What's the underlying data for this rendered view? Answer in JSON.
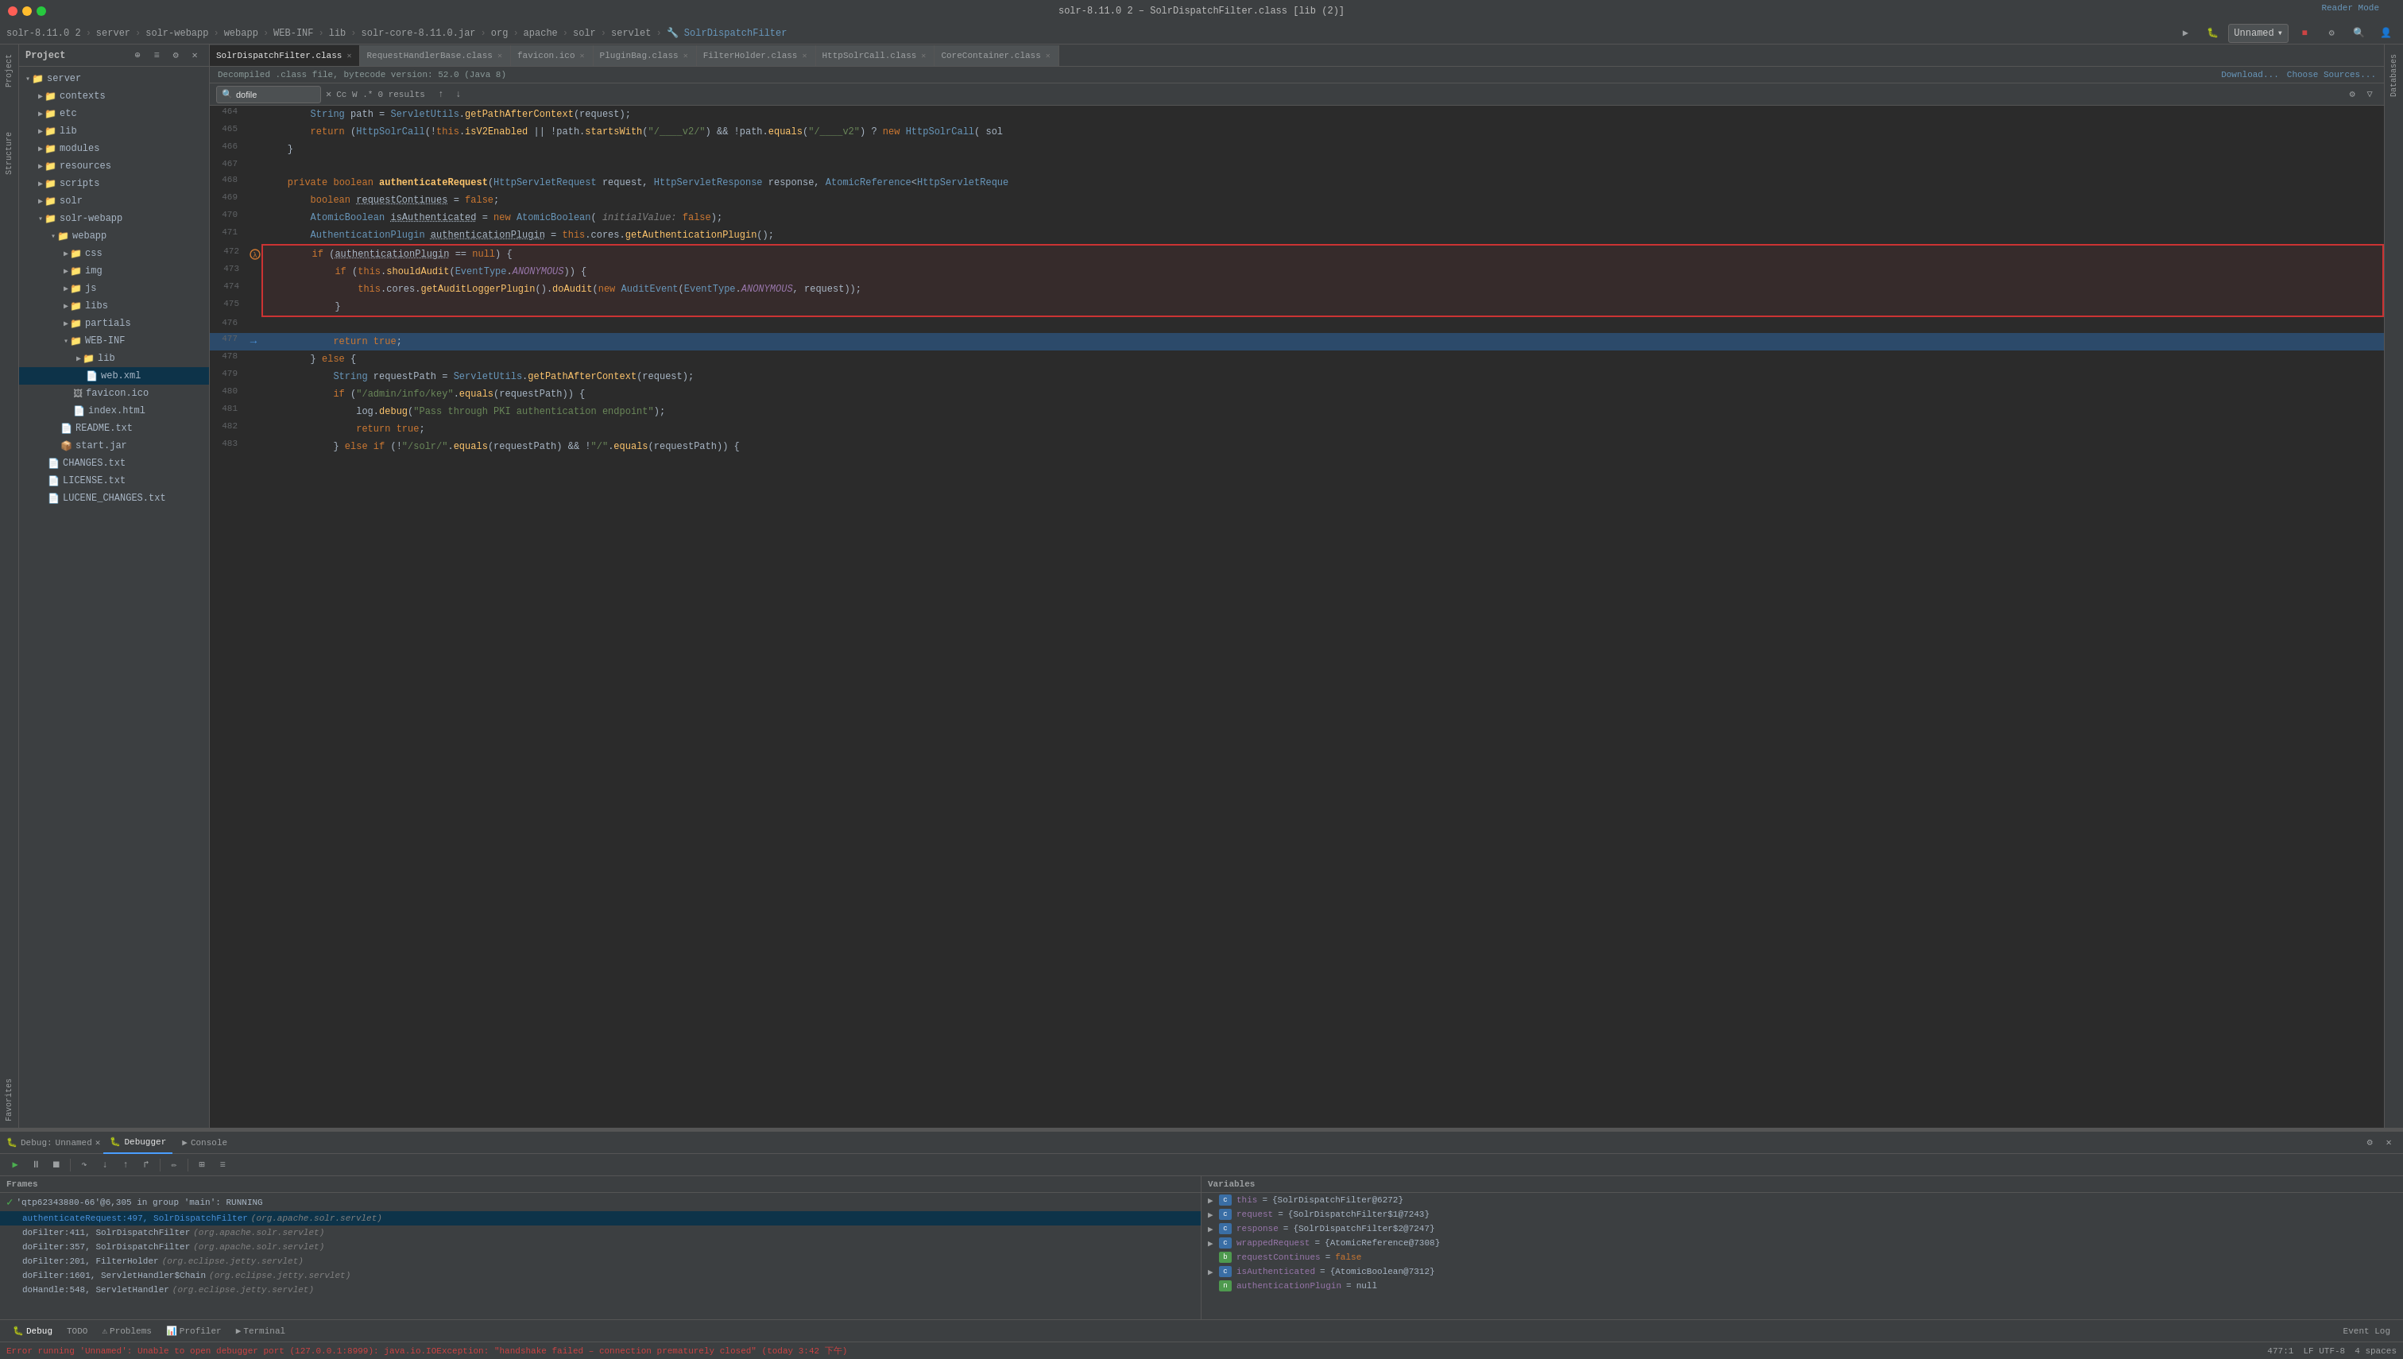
{
  "titleBar": {
    "title": "solr-8.11.0 2 – SolrDispatchFilter.class [lib (2)]"
  },
  "navBar": {
    "items": [
      "solr-8.11.0 2",
      "server",
      "solr-webapp",
      "webapp",
      "WEB-INF",
      "lib",
      "solr-core-8.11.0.jar",
      "org",
      "apache",
      "solr",
      "servlet",
      "SolrDispatchFilter"
    ]
  },
  "tabs": [
    {
      "label": "SolrDispatchFilter.class",
      "active": true
    },
    {
      "label": "RequestHandlerBase.class",
      "active": false
    },
    {
      "label": "favicon.ico",
      "active": false
    },
    {
      "label": "PluginBag.class",
      "active": false
    },
    {
      "label": "FilterHolder.class",
      "active": false
    },
    {
      "label": "HttpSolrCall.class",
      "active": false
    },
    {
      "label": "CoreContainer.class",
      "active": false
    }
  ],
  "fileBanner": {
    "text": "Decompiled .class file, bytecode version: 52.0 (Java 8)",
    "downloadLabel": "Download...",
    "chooseSourcesLabel": "Choose Sources..."
  },
  "searchBar": {
    "placeholder": "dofile",
    "value": "dofile",
    "results": "0 results"
  },
  "readerMode": "Reader Mode",
  "codeLines": [
    {
      "num": 464,
      "text": "        String path = ServletUtils.getPathAfterContext(request);"
    },
    {
      "num": 465,
      "text": "        return (HttpSolrCall(!this.isV2Enabled || !path.startsWith(\"/____v2/\") && !path.equals(\"/____v2\") ? new HttpSolrCall( sol"
    },
    {
      "num": 466,
      "text": "    }"
    },
    {
      "num": 467,
      "text": ""
    },
    {
      "num": 468,
      "text": "    private boolean authenticateRequest(HttpServletRequest request, HttpServletResponse response, AtomicReference<HttpServletReque"
    },
    {
      "num": 469,
      "text": "        boolean requestContinues = false;"
    },
    {
      "num": 470,
      "text": "        AtomicBoolean isAuthenticated = new AtomicBoolean( initialValue: false);"
    },
    {
      "num": 471,
      "text": "        AuthenticationPlugin authenticationPlugin = this.cores.getAuthenticationPlugin();"
    },
    {
      "num": 472,
      "text": "        if (authenticationPlugin == null) {",
      "redBox": "top"
    },
    {
      "num": 473,
      "text": "            if (this.shouldAudit(EventType.ANONYMOUS)) {",
      "redBox": "mid"
    },
    {
      "num": 474,
      "text": "                this.cores.getAuditLoggerPlugin().doAudit(new AuditEvent(EventType.ANONYMOUS, request));",
      "redBox": "mid"
    },
    {
      "num": 475,
      "text": "            }",
      "redBox": "bottom"
    },
    {
      "num": 476,
      "text": ""
    },
    {
      "num": 477,
      "text": "            return true;",
      "current": true
    },
    {
      "num": 478,
      "text": "        } else {"
    },
    {
      "num": 479,
      "text": "            String requestPath = ServletUtils.getPathAfterContext(request);"
    },
    {
      "num": 480,
      "text": "            if (\"/admin/info/key\".equals(requestPath)) {"
    },
    {
      "num": 481,
      "text": "                log.debug(\"Pass through PKI authentication endpoint\");"
    },
    {
      "num": 482,
      "text": "                return true;"
    },
    {
      "num": 483,
      "text": "            } else if (!\"/solr/\".equals(requestPath) && !\"/\".equals(requestPath)) {"
    }
  ],
  "sidebar": {
    "title": "Project",
    "items": [
      {
        "label": "server",
        "type": "folder",
        "level": 1,
        "open": true
      },
      {
        "label": "contexts",
        "type": "folder",
        "level": 2,
        "open": false
      },
      {
        "label": "etc",
        "type": "folder",
        "level": 2,
        "open": false
      },
      {
        "label": "lib",
        "type": "folder",
        "level": 2,
        "open": false
      },
      {
        "label": "modules",
        "type": "folder",
        "level": 2,
        "open": false
      },
      {
        "label": "resources",
        "type": "folder",
        "level": 2,
        "open": false
      },
      {
        "label": "scripts",
        "type": "folder",
        "level": 2,
        "open": false
      },
      {
        "label": "solr",
        "type": "folder",
        "level": 2,
        "open": false
      },
      {
        "label": "solr-webapp",
        "type": "folder",
        "level": 2,
        "open": true
      },
      {
        "label": "webapp",
        "type": "folder",
        "level": 3,
        "open": true
      },
      {
        "label": "css",
        "type": "folder",
        "level": 4,
        "open": false
      },
      {
        "label": "img",
        "type": "folder",
        "level": 4,
        "open": false
      },
      {
        "label": "js",
        "type": "folder",
        "level": 4,
        "open": false
      },
      {
        "label": "libs",
        "type": "folder",
        "level": 4,
        "open": false
      },
      {
        "label": "partials",
        "type": "folder",
        "level": 4,
        "open": false
      },
      {
        "label": "WEB-INF",
        "type": "folder",
        "level": 4,
        "open": true
      },
      {
        "label": "lib",
        "type": "folder",
        "level": 5,
        "open": false
      },
      {
        "label": "web.xml",
        "type": "xml",
        "level": 5,
        "selected": true
      },
      {
        "label": "favicon.ico",
        "type": "file",
        "level": 4
      },
      {
        "label": "index.html",
        "type": "file",
        "level": 4
      },
      {
        "label": "README.txt",
        "type": "txt",
        "level": 3
      },
      {
        "label": "start.jar",
        "type": "jar",
        "level": 3
      },
      {
        "label": "CHANGES.txt",
        "type": "txt",
        "level": 2
      },
      {
        "label": "LICENSE.txt",
        "type": "txt",
        "level": 2
      },
      {
        "label": "LUCENE_CHANGES.txt",
        "type": "txt",
        "level": 2
      }
    ]
  },
  "debugPanel": {
    "title": "Unnamed",
    "tabs": [
      "Debugger",
      "Console"
    ],
    "debuggerLabel": "Debug:",
    "framesHeader": "Frames",
    "variablesHeader": "Variables",
    "frames": [
      {
        "status": "running",
        "text": "'qtp62343880-66'@6,305 in group 'main': RUNNING",
        "selected": false
      },
      {
        "text": "authenticateRequest:497, SolrDispatchFilter",
        "pkg": "(org.apache.solr.servlet)",
        "selected": true,
        "hasBreak": false
      },
      {
        "text": "doFilter:411, SolrDispatchFilter",
        "pkg": "(org.apache.solr.servlet)",
        "selected": false
      },
      {
        "text": "doFilter:357, SolrDispatchFilter",
        "pkg": "(org.apache.solr.servlet)",
        "selected": false
      },
      {
        "text": "doFilter:201, FilterHolder",
        "pkg": "(org.eclipse.jetty.servlet)",
        "selected": false
      },
      {
        "text": "doFilter:1601, ServletHandler$Chain",
        "pkg": "(org.eclipse.jetty.servlet)",
        "selected": false
      },
      {
        "text": "doHandle:548, ServletHandler",
        "pkg": "(org.eclipse.jetty.servlet)",
        "selected": false
      }
    ],
    "variables": [
      {
        "name": "this",
        "value": "{SolrDispatchFilter@6272}",
        "type": "obj",
        "expanded": false,
        "level": 0
      },
      {
        "name": "request",
        "value": "{SolrDispatchFilter$1@7243}",
        "type": "obj",
        "expanded": false,
        "level": 0
      },
      {
        "name": "response",
        "value": "{SolrDispatchFilter$2@7247}",
        "type": "obj",
        "expanded": false,
        "level": 0
      },
      {
        "name": "wrappedRequest",
        "value": "{AtomicReference@7308}",
        "type": "obj",
        "expanded": false,
        "level": 0
      },
      {
        "name": "requestContinues",
        "value": "false",
        "type": "bool",
        "expanded": false,
        "level": 1
      },
      {
        "name": "isAuthenticated",
        "value": "{AtomicBoolean@7312}",
        "type": "obj",
        "expanded": false,
        "level": 0
      },
      {
        "name": "authenticationPlugin",
        "value": "null",
        "type": "null",
        "expanded": false,
        "level": 1
      }
    ]
  },
  "statusBar": {
    "error": "Error running 'Unnamed': Unable to open debugger port (127.0.0.1:8999): java.io.IOException: \"handshake failed – connection prematurely closed\" (today 3:42 下午)",
    "position": "477:1",
    "encoding": "LF UTF-8",
    "spaces": "4 spaces"
  },
  "bottomToolbar": {
    "items": [
      "Debug",
      "TODO",
      "Problems",
      "Profiler",
      "Terminal"
    ],
    "eventLog": "Event Log"
  }
}
